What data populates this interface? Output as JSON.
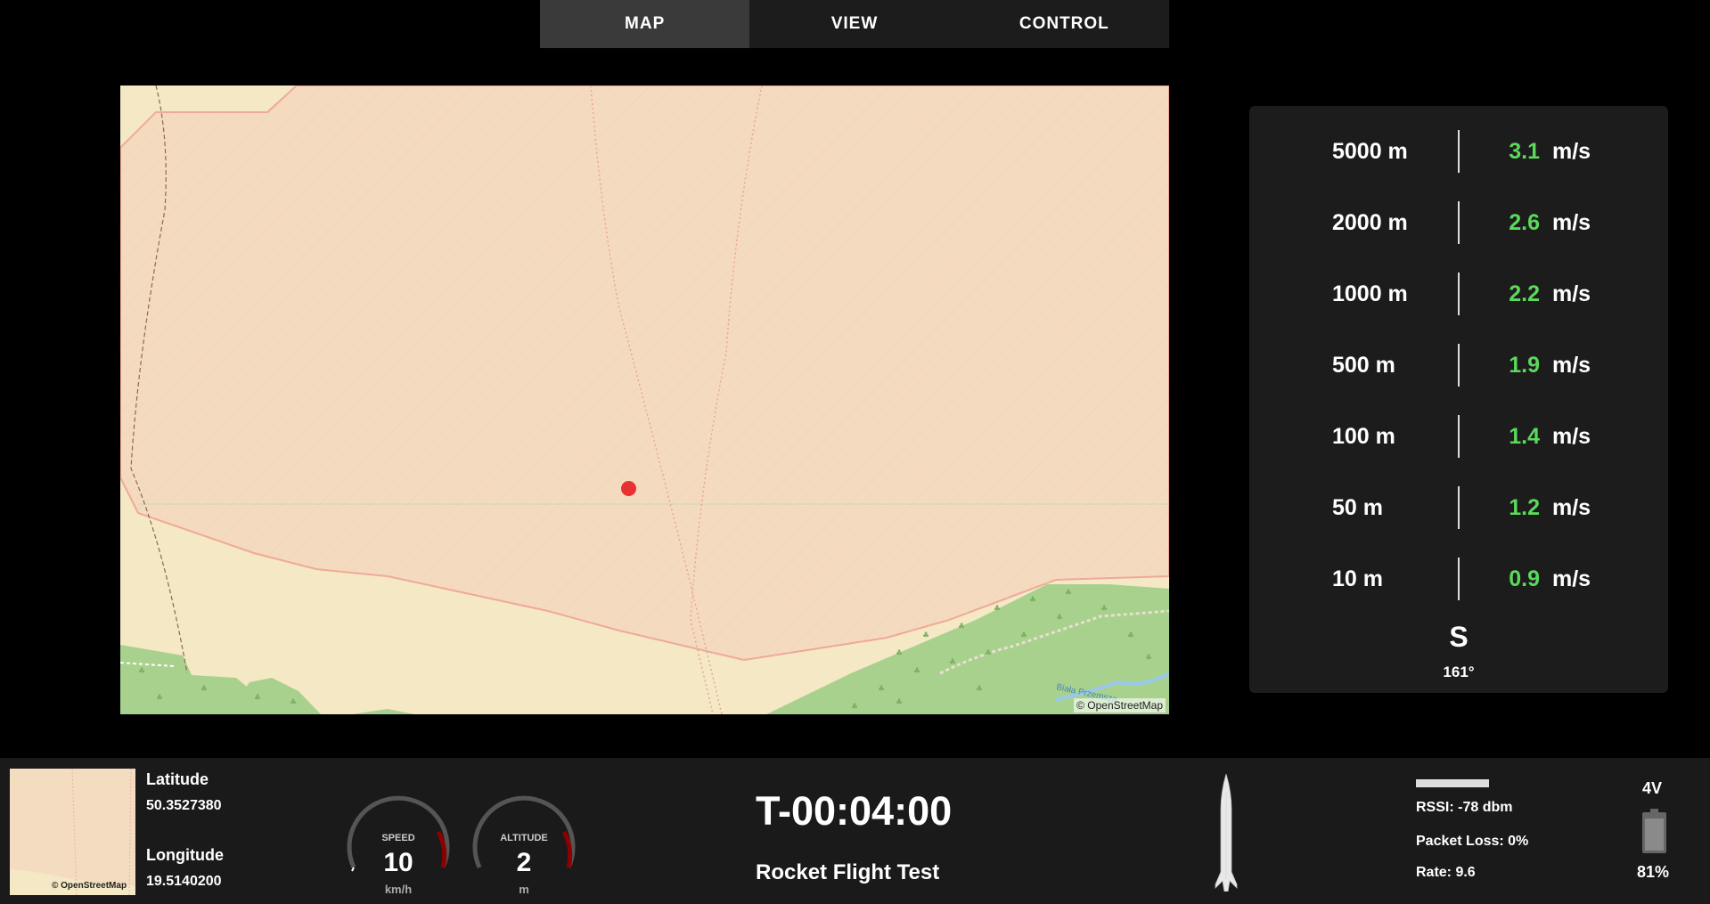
{
  "tabs": [
    {
      "label": "MAP",
      "active": true
    },
    {
      "label": "VIEW",
      "active": false
    },
    {
      "label": "CONTROL",
      "active": false
    }
  ],
  "map": {
    "attribution": "© OpenStreetMap",
    "labels": [
      "Biała Przemsza"
    ],
    "marker_color": "#e03030"
  },
  "wind": {
    "rows": [
      {
        "altitude": "5000 m",
        "speed": "3.1",
        "unit": "m/s"
      },
      {
        "altitude": "2000 m",
        "speed": "2.6",
        "unit": "m/s"
      },
      {
        "altitude": "1000 m",
        "speed": "2.2",
        "unit": "m/s"
      },
      {
        "altitude": "500 m",
        "speed": "1.9",
        "unit": "m/s"
      },
      {
        "altitude": "100 m",
        "speed": "1.4",
        "unit": "m/s"
      },
      {
        "altitude": "50 m",
        "speed": "1.2",
        "unit": "m/s"
      },
      {
        "altitude": "10 m",
        "speed": "0.9",
        "unit": "m/s"
      }
    ],
    "direction": "S",
    "degrees": "161°",
    "speed_color": "#5bd95b"
  },
  "bottom": {
    "minimap_attribution": "© OpenStreetMap",
    "latitude_label": "Latitude",
    "latitude": "50.3527380",
    "longitude_label": "Longitude",
    "longitude": "19.5140200",
    "speed_gauge": {
      "title": "SPEED",
      "value": "10",
      "unit": "km/h"
    },
    "altitude_gauge": {
      "title": "ALTITUDE",
      "value": "2",
      "unit": "m"
    },
    "timer": "T-00:04:00",
    "mission": "Rocket Flight Test",
    "rssi": "RSSI: -78 dbm",
    "packet_loss": "Packet Loss: 0%",
    "rate": "Rate: 9.6",
    "battery_voltage": "4V",
    "battery_percent": "81%"
  }
}
